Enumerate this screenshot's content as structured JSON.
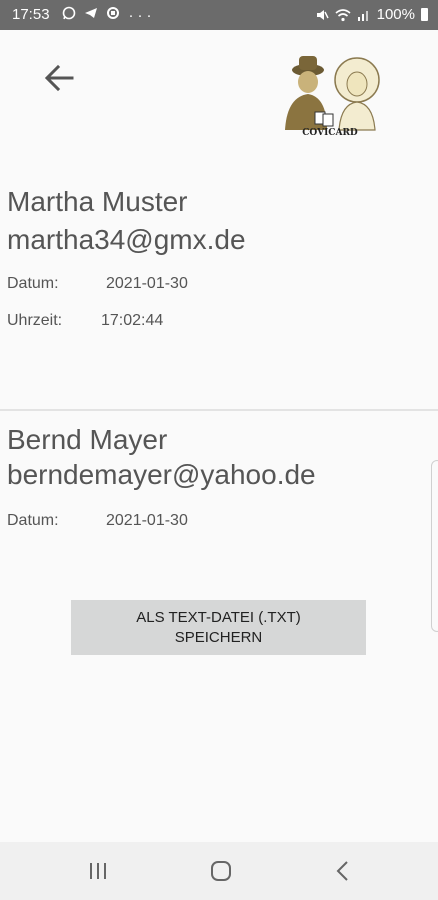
{
  "status_bar": {
    "time": "17:53",
    "left_icons": [
      "whatsapp-icon",
      "telegram-icon",
      "sync-icon",
      "more-icon"
    ],
    "battery": "100%"
  },
  "header": {
    "logo_text": "COVICARD"
  },
  "entries": [
    {
      "name": "Martha Muster",
      "email": "martha34@gmx.de",
      "date_label": "Datum:",
      "date_value": "2021-01-30",
      "time_label": "Uhrzeit:",
      "time_value": "17:02:44"
    },
    {
      "name": "Bernd Mayer",
      "email": "berndemayer@yahoo.de",
      "date_label": "Datum:",
      "date_value": "2021-01-30"
    }
  ],
  "actions": {
    "save_label": "ALS TEXT-DATEI (.TXT) SPEICHERN"
  },
  "nav_bar": {
    "buttons": [
      "recents-icon",
      "home-icon",
      "back-icon"
    ]
  }
}
